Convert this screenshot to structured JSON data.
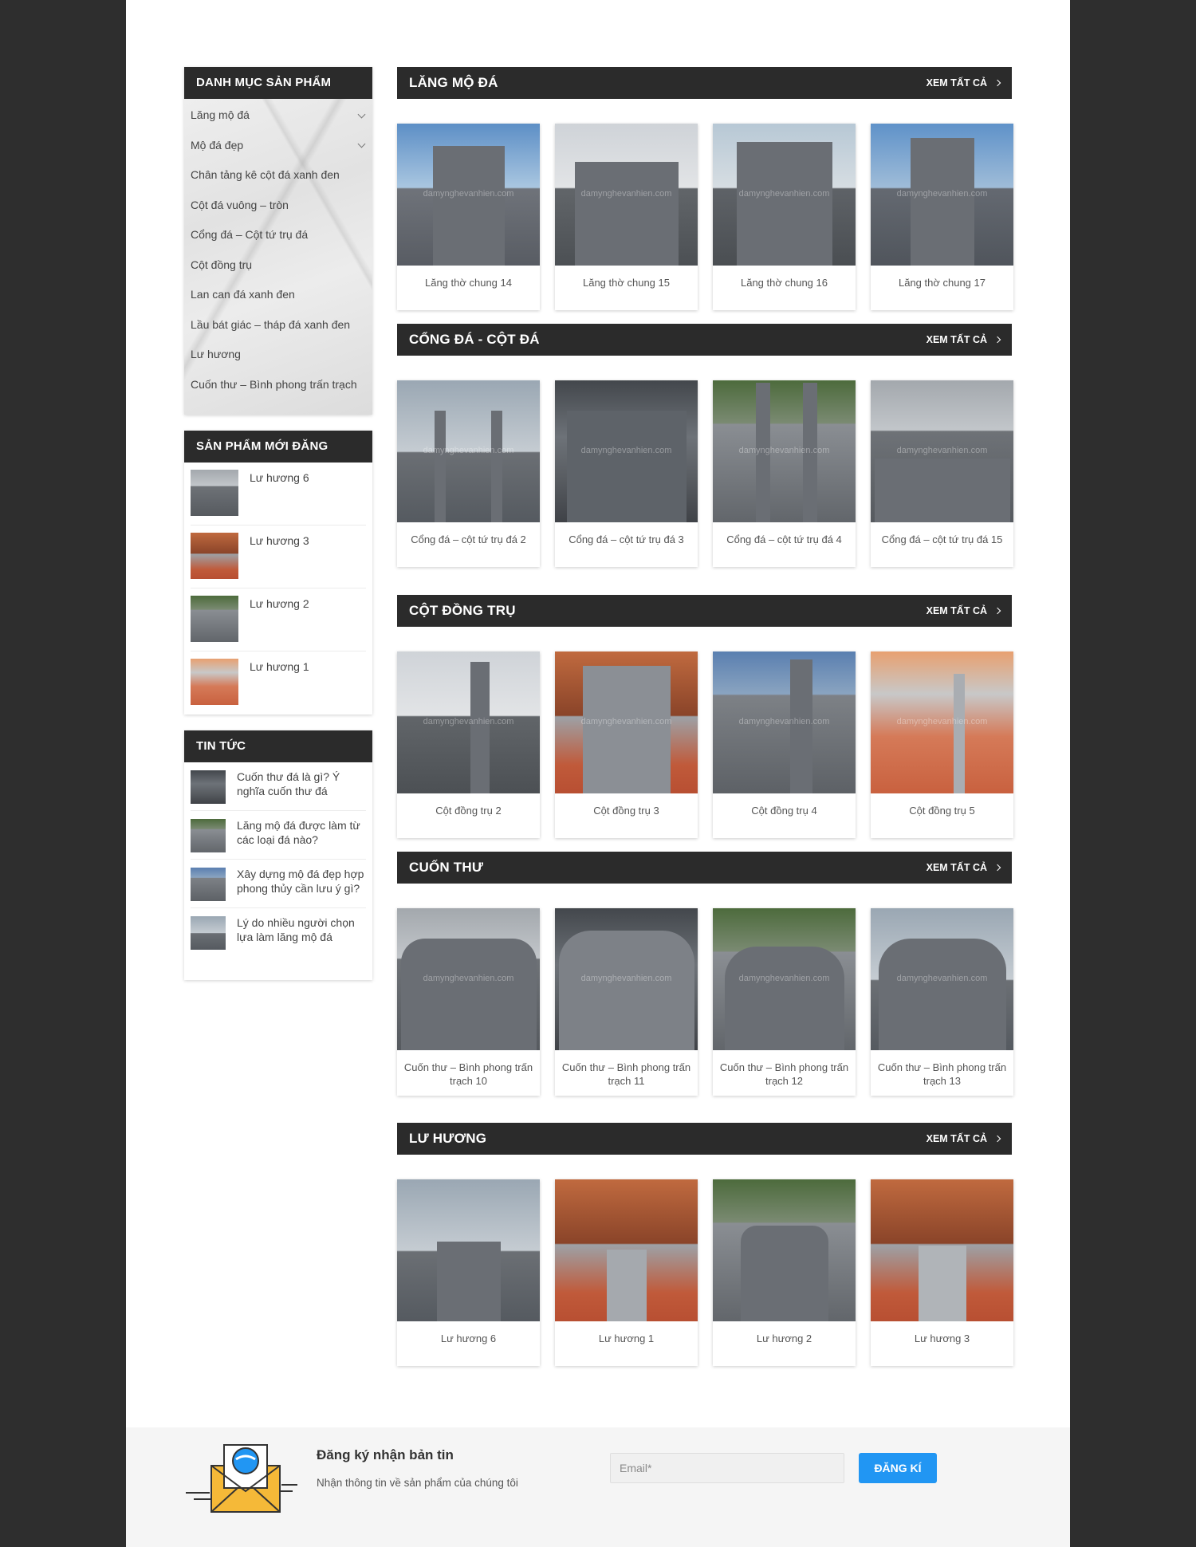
{
  "sidebar": {
    "categories": {
      "title": "DANH MỤC SẢN PHẨM",
      "items": [
        {
          "label": "Lăng mộ đá",
          "has_children": true
        },
        {
          "label": "Mộ đá đẹp",
          "has_children": true
        },
        {
          "label": "Chân tảng kê cột đá xanh đen",
          "has_children": false
        },
        {
          "label": "Cột đá vuông – tròn",
          "has_children": false
        },
        {
          "label": "Cổng đá – Cột tứ trụ đá",
          "has_children": false
        },
        {
          "label": "Cột đồng trụ",
          "has_children": false
        },
        {
          "label": "Lan can đá xanh đen",
          "has_children": false
        },
        {
          "label": "Lầu bát giác – tháp đá xanh đen",
          "has_children": false
        },
        {
          "label": "Lư hương",
          "has_children": false
        },
        {
          "label": "Cuốn thư – Bình phong trấn trạch",
          "has_children": false
        }
      ]
    },
    "new_products": {
      "title": "SẢN PHẨM MỚI ĐĂNG",
      "items": [
        {
          "name": "Lư hương 6"
        },
        {
          "name": "Lư hương 3"
        },
        {
          "name": "Lư hương 2"
        },
        {
          "name": "Lư hương 1"
        }
      ]
    },
    "news": {
      "title": "TIN TỨC",
      "items": [
        {
          "title": "Cuốn thư đá là gì? Ý nghĩa cuốn thư đá"
        },
        {
          "title": "Lăng mộ đá được làm từ các loại đá nào?"
        },
        {
          "title": "Xây dựng mộ đá đẹp hợp phong thủy cần lưu ý gì?"
        },
        {
          "title": "Lý do nhiều người chọn lựa làm lăng mộ đá"
        }
      ]
    }
  },
  "see_all_label": "XEM TẤT CẢ",
  "watermark": "damynghevanhien.com",
  "sections": [
    {
      "title": "LĂNG MỘ ĐÁ",
      "products": [
        "Lăng thờ chung 14",
        "Lăng thờ chung 15",
        "Lăng thờ chung 16",
        "Lăng thờ chung 17"
      ]
    },
    {
      "title": "CỔNG ĐÁ - CỘT ĐÁ",
      "products": [
        "Cổng đá – cột tứ trụ đá 2",
        "Cổng đá – cột tứ trụ đá 3",
        "Cổng đá – cột tứ trụ đá 4",
        "Cổng đá – cột tứ trụ đá 15"
      ]
    },
    {
      "title": "CỘT ĐỒNG TRỤ",
      "products": [
        "Cột đồng trụ 2",
        "Cột đồng trụ 3",
        "Cột đồng trụ 4",
        "Cột đồng trụ 5"
      ]
    },
    {
      "title": "CUỐN THƯ",
      "products": [
        "Cuốn thư – Bình phong trấn trạch 10",
        "Cuốn thư – Bình phong trấn trạch 11",
        "Cuốn thư – Bình phong trấn trạch 12",
        "Cuốn thư – Bình phong trấn trạch 13"
      ]
    },
    {
      "title": "LƯ HƯƠNG",
      "products": [
        "Lư hương 6",
        "Lư hương 1",
        "Lư hương 2",
        "Lư hương 3"
      ]
    }
  ],
  "newsletter": {
    "title": "Đăng ký nhận bản tin",
    "subtitle": "Nhận thông tin về sản phẩm của chúng tôi",
    "email_placeholder": "Email*",
    "button_label": "ĐĂNG KÍ",
    "button_color": "#2196f3"
  },
  "colors": {
    "page_bg": "#2e2e2e",
    "content_bg": "#ffffff",
    "header_bar": "#2b2b2b"
  }
}
